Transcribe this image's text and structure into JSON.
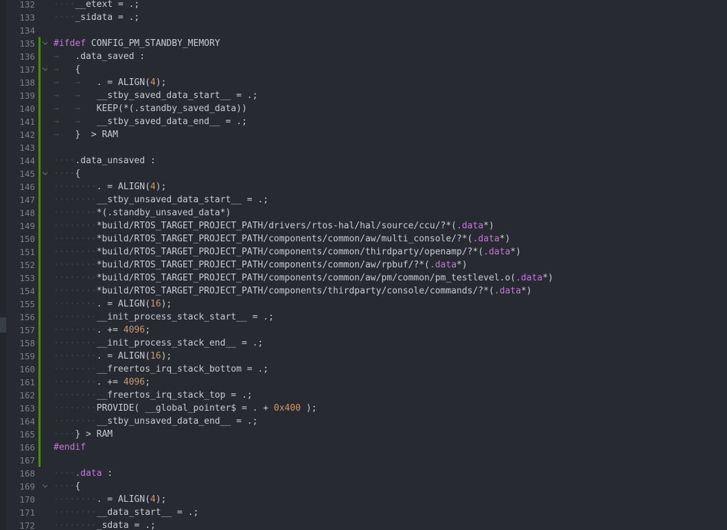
{
  "editor": {
    "language": "linker-script",
    "colors": {
      "background": "#272a30",
      "text": "#c8ccd4",
      "line_number": "#7b808a",
      "whitespace_marker": "#464a53",
      "preprocessor": "#c678dd",
      "number": "#d19a66",
      "section_name": "#c678dd",
      "modified_bar": "#4f8a10"
    }
  },
  "lines": [
    {
      "n": "132",
      "indent": "····",
      "segs": [
        [
          "__etext",
          "t"
        ],
        [
          " = .;",
          "t"
        ]
      ]
    },
    {
      "n": "133",
      "indent": "····",
      "segs": [
        [
          "_sidata",
          "t"
        ],
        [
          " = .;",
          "t"
        ]
      ]
    },
    {
      "n": "134",
      "indent": "",
      "segs": []
    },
    {
      "n": "135",
      "fold": true,
      "bar": true,
      "indent": "",
      "segs": [
        [
          "#ifdef",
          "p"
        ],
        [
          " CONFIG_PM_STANDBY_MEMORY",
          "t"
        ]
      ]
    },
    {
      "n": "136",
      "bar": true,
      "indent": "→   ",
      "segs": [
        [
          ".data_saved",
          "t"
        ],
        [
          " :",
          "t"
        ]
      ]
    },
    {
      "n": "137",
      "fold": true,
      "bar": true,
      "indent": "→   ",
      "segs": [
        [
          "{",
          "t"
        ]
      ]
    },
    {
      "n": "138",
      "bar": true,
      "indent": "→   →   ",
      "segs": [
        [
          ". = ALIGN(",
          "t"
        ],
        [
          "4",
          "n"
        ],
        [
          ");",
          "t"
        ]
      ]
    },
    {
      "n": "139",
      "bar": true,
      "indent": "→   →   ",
      "segs": [
        [
          "__stby_saved_data_start__ = .;",
          "t"
        ]
      ]
    },
    {
      "n": "140",
      "bar": true,
      "indent": "→   →   ",
      "segs": [
        [
          "KEEP(*(.standby_saved_data))",
          "t"
        ]
      ]
    },
    {
      "n": "141",
      "bar": true,
      "indent": "→   →   ",
      "segs": [
        [
          "__stby_saved_data_end__ = .;",
          "t"
        ]
      ]
    },
    {
      "n": "142",
      "bar": true,
      "indent": "→   ",
      "segs": [
        [
          "}  > RAM",
          "t"
        ]
      ]
    },
    {
      "n": "143",
      "bar": true,
      "indent": "",
      "segs": []
    },
    {
      "n": "144",
      "bar": true,
      "indent": "····",
      "segs": [
        [
          ".data_unsaved :",
          "t"
        ]
      ]
    },
    {
      "n": "145",
      "fold": true,
      "bar": true,
      "indent": "····",
      "segs": [
        [
          "{",
          "t"
        ]
      ]
    },
    {
      "n": "146",
      "bar": true,
      "indent": "········",
      "segs": [
        [
          ". = ALIGN(",
          "t"
        ],
        [
          "4",
          "n"
        ],
        [
          ");",
          "t"
        ]
      ]
    },
    {
      "n": "147",
      "bar": true,
      "indent": "········",
      "segs": [
        [
          "__stby_unsaved_data_start__ = .;",
          "t"
        ]
      ]
    },
    {
      "n": "148",
      "bar": true,
      "indent": "········",
      "segs": [
        [
          "*(.standby_unsaved_data*)",
          "t"
        ]
      ]
    },
    {
      "n": "149",
      "bar": true,
      "indent": "········",
      "segs": [
        [
          "*build/RTOS_TARGET_PROJECT_PATH/drivers/rtos-hal/hal/source/ccu/?*(",
          "t"
        ],
        [
          ".data",
          "s"
        ],
        [
          "*)",
          "t"
        ]
      ]
    },
    {
      "n": "150",
      "bar": true,
      "indent": "········",
      "segs": [
        [
          "*build/RTOS_TARGET_PROJECT_PATH/components/common/aw/multi_console/?*(",
          "t"
        ],
        [
          ".data",
          "s"
        ],
        [
          "*)",
          "t"
        ]
      ]
    },
    {
      "n": "151",
      "bar": true,
      "indent": "········",
      "segs": [
        [
          "*build/RTOS_TARGET_PROJECT_PATH/components/common/thirdparty/openamp/?*(",
          "t"
        ],
        [
          ".data",
          "s"
        ],
        [
          "*)",
          "t"
        ]
      ]
    },
    {
      "n": "152",
      "bar": true,
      "indent": "········",
      "segs": [
        [
          "*build/RTOS_TARGET_PROJECT_PATH/components/common/aw/rpbuf/?*(",
          "t"
        ],
        [
          ".data",
          "s"
        ],
        [
          "*)",
          "t"
        ]
      ]
    },
    {
      "n": "153",
      "bar": true,
      "indent": "········",
      "segs": [
        [
          "*build/RTOS_TARGET_PROJECT_PATH/components/common/aw/pm/common/pm_testlevel.o(",
          "t"
        ],
        [
          ".data",
          "s"
        ],
        [
          "*)",
          "t"
        ]
      ]
    },
    {
      "n": "154",
      "bar": true,
      "indent": "········",
      "segs": [
        [
          "*build/RTOS_TARGET_PROJECT_PATH/components/thirdparty/console/commands/?*(",
          "t"
        ],
        [
          ".data",
          "s"
        ],
        [
          "*)",
          "t"
        ]
      ]
    },
    {
      "n": "155",
      "bar": true,
      "indent": "········",
      "segs": [
        [
          ". = ALIGN(",
          "t"
        ],
        [
          "16",
          "n"
        ],
        [
          ");",
          "t"
        ]
      ]
    },
    {
      "n": "156",
      "bar": true,
      "indent": "········",
      "segs": [
        [
          "__init_process_stack_start__ = .;",
          "t"
        ]
      ]
    },
    {
      "n": "157",
      "bar": true,
      "indent": "········",
      "segs": [
        [
          ". += ",
          "t"
        ],
        [
          "4096",
          "n"
        ],
        [
          ";",
          "t"
        ]
      ]
    },
    {
      "n": "158",
      "bar": true,
      "indent": "········",
      "segs": [
        [
          "__init_process_stack_end__ = .;",
          "t"
        ]
      ]
    },
    {
      "n": "159",
      "bar": true,
      "indent": "········",
      "segs": [
        [
          ". = ALIGN(",
          "t"
        ],
        [
          "16",
          "n"
        ],
        [
          ");",
          "t"
        ]
      ]
    },
    {
      "n": "160",
      "bar": true,
      "indent": "········",
      "segs": [
        [
          "__freertos_irq_stack_bottom = .;",
          "t"
        ]
      ]
    },
    {
      "n": "161",
      "bar": true,
      "indent": "········",
      "segs": [
        [
          ". += ",
          "t"
        ],
        [
          "4096",
          "n"
        ],
        [
          ";",
          "t"
        ]
      ]
    },
    {
      "n": "162",
      "bar": true,
      "indent": "········",
      "segs": [
        [
          "__freertos_irq_stack_top = .;",
          "t"
        ]
      ]
    },
    {
      "n": "163",
      "bar": true,
      "indent": "········",
      "segs": [
        [
          "PROVIDE( __global_pointer$ = . + ",
          "t"
        ],
        [
          "0x400",
          "n"
        ],
        [
          " );",
          "t"
        ]
      ]
    },
    {
      "n": "164",
      "bar": true,
      "indent": "········",
      "segs": [
        [
          "__stby_unsaved_data_end__ = .;",
          "t"
        ]
      ]
    },
    {
      "n": "165",
      "bar": true,
      "indent": "····",
      "segs": [
        [
          "} > RAM",
          "t"
        ]
      ]
    },
    {
      "n": "166",
      "bar": true,
      "indent": "",
      "segs": [
        [
          "#endif",
          "p"
        ]
      ]
    },
    {
      "n": "167",
      "bar": true,
      "indent": "",
      "segs": []
    },
    {
      "n": "168",
      "indent": "····",
      "segs": [
        [
          ".data",
          "s"
        ],
        [
          " :",
          "t"
        ]
      ]
    },
    {
      "n": "169",
      "fold": true,
      "indent": "····",
      "segs": [
        [
          "{",
          "t"
        ]
      ]
    },
    {
      "n": "170",
      "indent": "········",
      "segs": [
        [
          ". = ALIGN(",
          "t"
        ],
        [
          "4",
          "n"
        ],
        [
          ");",
          "t"
        ]
      ]
    },
    {
      "n": "171",
      "indent": "········",
      "segs": [
        [
          "__data_start__ = .;",
          "t"
        ]
      ]
    },
    {
      "n": "172",
      "indent": "········",
      "segs": [
        [
          "_sdata = .;",
          "t"
        ]
      ]
    }
  ]
}
